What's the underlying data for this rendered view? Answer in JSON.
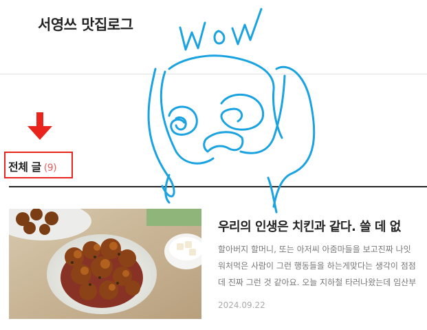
{
  "blog": {
    "title": "서영쓰 맛집로그"
  },
  "category": {
    "label": "전체 글",
    "count": "(9)"
  },
  "posts": [
    {
      "title": "우리의 인생은 치킨과 같다. 쓸 데 없",
      "excerpt_lines": [
        "할아버지 할머니, 또는 아저씨 아줌마들을 보고진짜 나잇",
        "워처먹은 사람이 그런 행동들을 하는게맞다는 생각이 점점",
        "데 진짜 그런 것 같아요. 오늘 지하철 타러나왔는데 임산부"
      ],
      "date": "2024.09.22"
    }
  ],
  "doodle": {
    "text": "WOW",
    "color": "#1aa3e0"
  },
  "colors": {
    "annotation_red": "#e8241c",
    "count_pink": "#e45e5e"
  }
}
